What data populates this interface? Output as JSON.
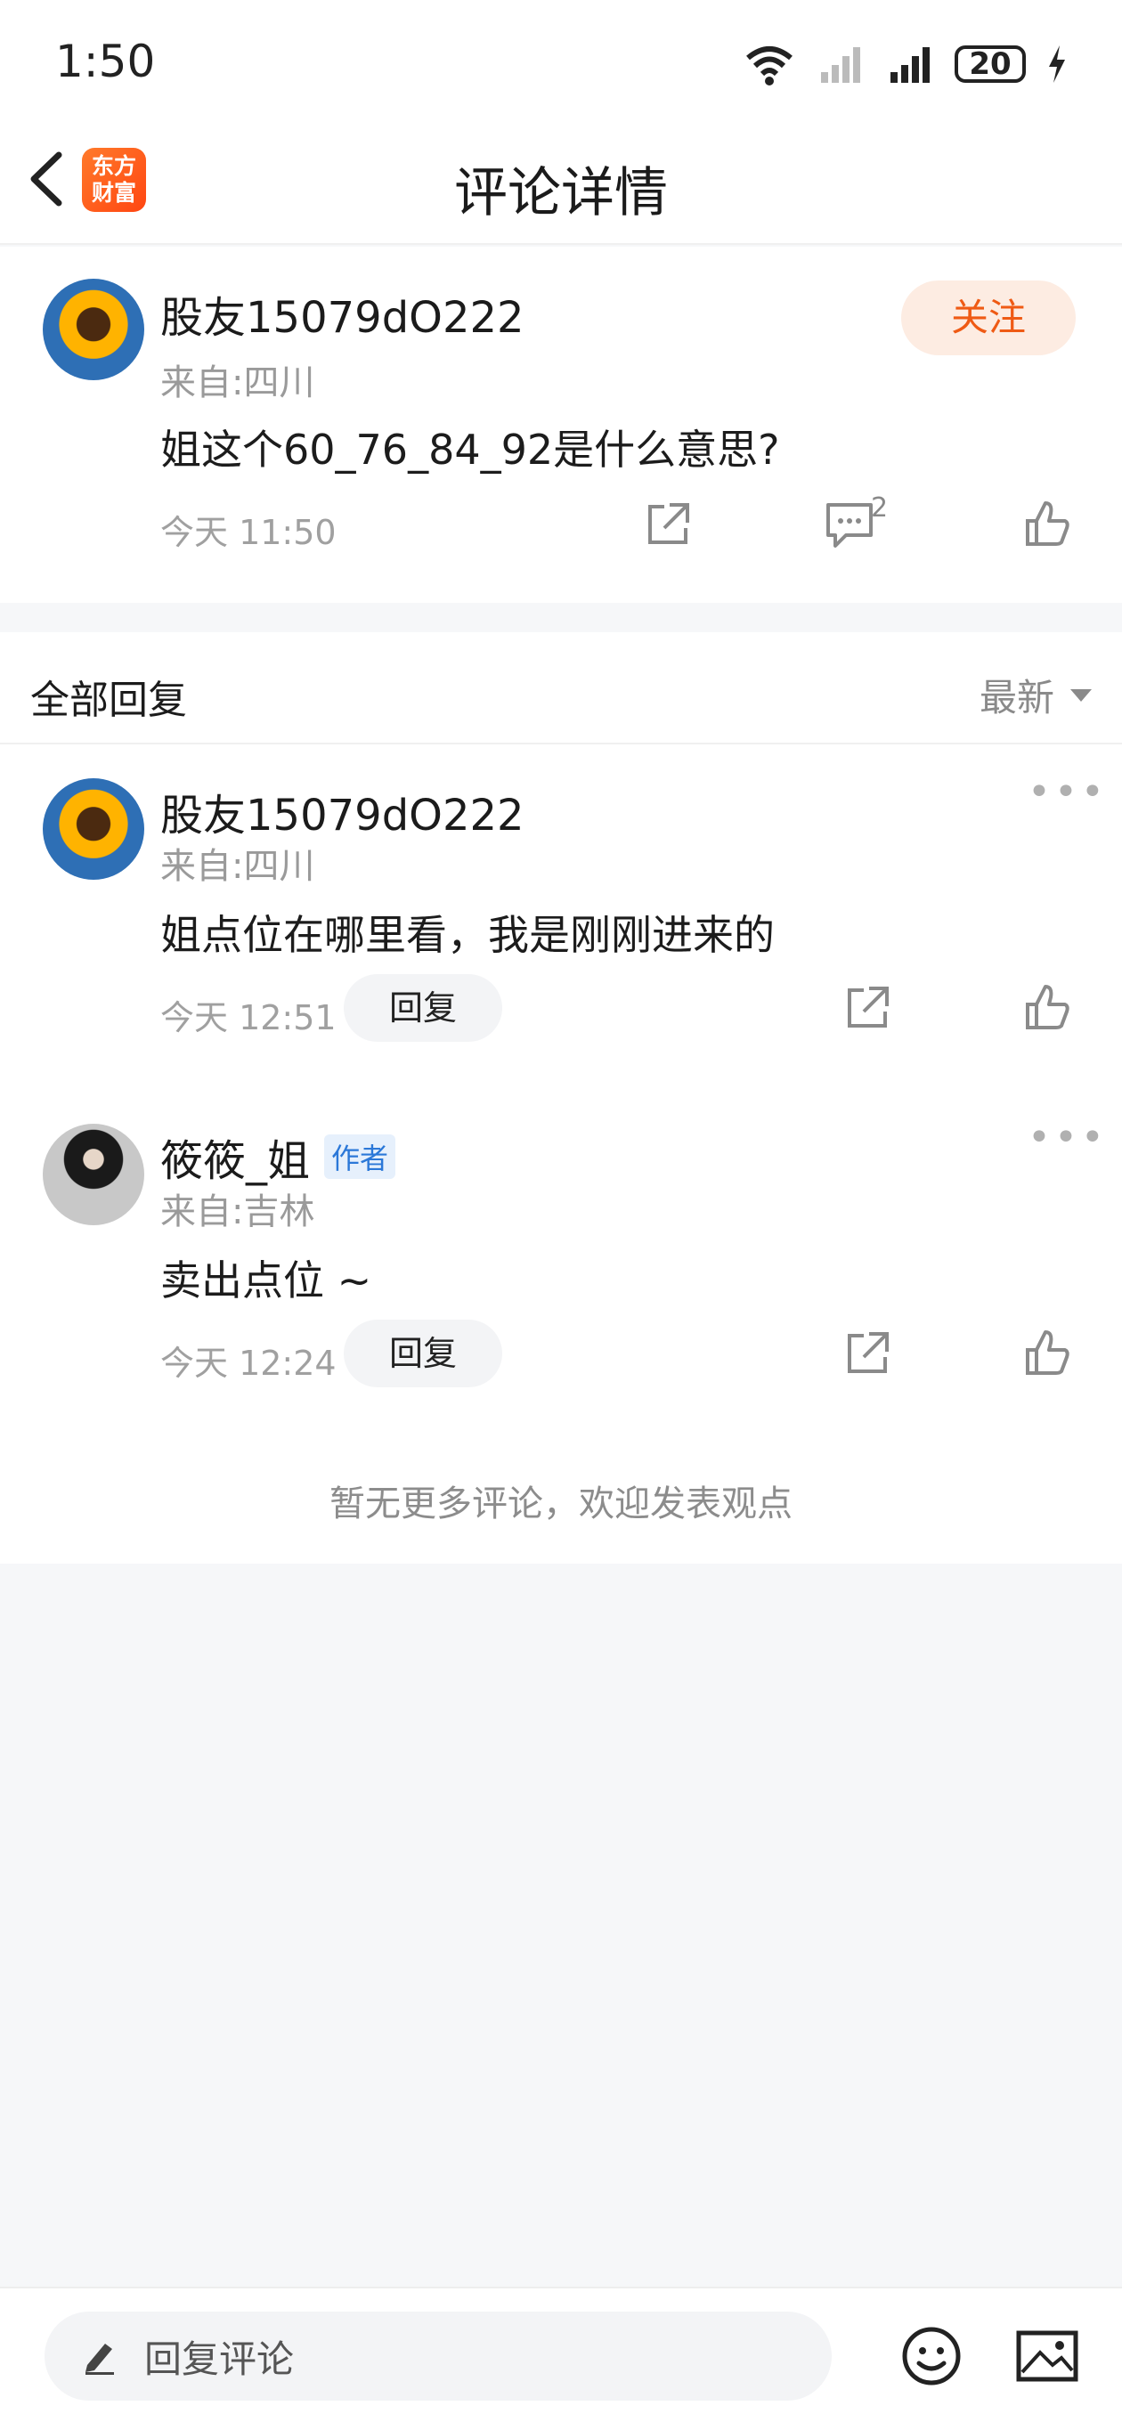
{
  "status_bar": {
    "time": "1:50",
    "battery": "20"
  },
  "nav": {
    "title": "评论详情",
    "logo_text_line1": "东方",
    "logo_text_line2": "财富"
  },
  "main_comment": {
    "username": "股友15079dO222",
    "from": "来自:四川",
    "text": "姐这个60_76_84_92是什么意思?",
    "time": "今天 11:50",
    "follow_label": "关注",
    "reply_count": "2"
  },
  "replies_section": {
    "title": "全部回复",
    "sort_label": "最新",
    "items": [
      {
        "username": "股友15079dO222",
        "from": "来自:四川",
        "text": "姐点位在哪里看，我是刚刚进来的",
        "time": "今天 12:51",
        "reply_label": "回复",
        "badge": ""
      },
      {
        "username": "筱筱_姐",
        "from": "来自:吉林",
        "text": "卖出点位 ~",
        "time": "今天 12:24",
        "reply_label": "回复",
        "badge": "作者"
      }
    ],
    "end_text": "暂无更多评论，欢迎发表观点"
  },
  "bottom_bar": {
    "placeholder": "回复评论"
  },
  "colors": {
    "accent": "#ef5a14",
    "follow_bg": "#fdece2",
    "author_badge": "#2b78d8",
    "page_bg": "#f6f7f9"
  },
  "icons": [
    "back-icon",
    "share-icon",
    "comment-icon",
    "like-icon",
    "pencil-icon",
    "emoji-icon",
    "image-icon",
    "wifi-icon",
    "signal-icon",
    "charging-icon"
  ]
}
